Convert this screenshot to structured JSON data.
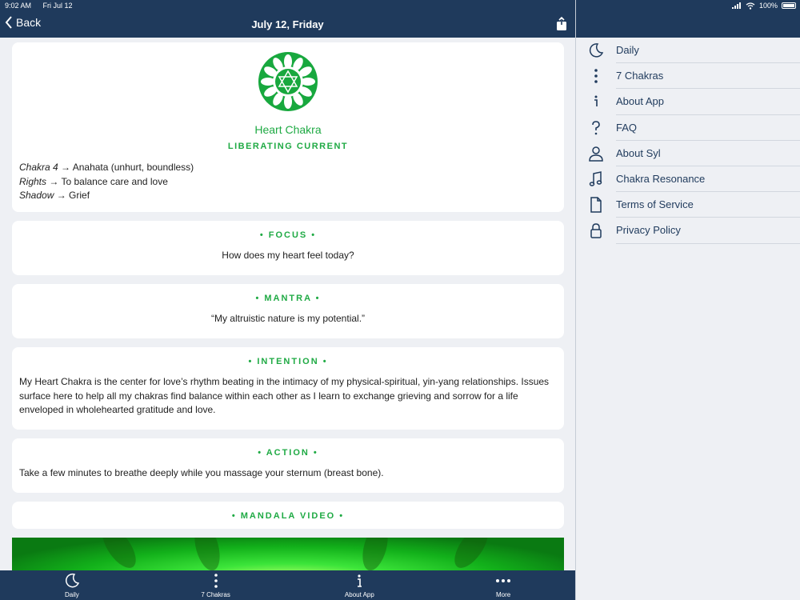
{
  "status": {
    "time": "9:02 AM",
    "date": "Fri Jul 12",
    "battery": "100%"
  },
  "nav": {
    "back_label": "Back",
    "title": "July 12, Friday"
  },
  "hero": {
    "name": "Heart Chakra",
    "subtitle": "LIBERATING CURRENT",
    "facts": [
      {
        "key": "Chakra 4",
        "arrow": " → ",
        "value": "Anahata (unhurt, boundless)"
      },
      {
        "key": "Rights",
        "arrow": " → ",
        "value": "To balance care and love"
      },
      {
        "key": "Shadow",
        "arrow": " → ",
        "value": "Grief"
      }
    ]
  },
  "sections": {
    "focus": {
      "title": "• FOCUS •",
      "body": "How does my heart feel today?"
    },
    "mantra": {
      "title": "• MANTRA •",
      "body": "“My altruistic nature is my potential.”"
    },
    "intention": {
      "title": "• INTENTION •",
      "body": "My Heart Chakra is the center for love’s rhythm beating in the intimacy of my physical-spiritual, yin-yang relationships. Issues surface here to help all my chakras find balance within each other as I learn to exchange grieving and sorrow for a life enveloped in wholehearted gratitude and love."
    },
    "action": {
      "title": "• ACTION •",
      "body": "Take a few minutes to breathe deeply while you massage your sternum (breast bone)."
    },
    "mandala": {
      "title": "• MANDALA VIDEO •"
    }
  },
  "tabs": [
    {
      "label": "Daily",
      "icon": "moon-icon"
    },
    {
      "label": "7 Chakras",
      "icon": "dots-vertical-icon"
    },
    {
      "label": "About App",
      "icon": "info-icon"
    },
    {
      "label": "More",
      "icon": "dots-horizontal-icon"
    }
  ],
  "menu": [
    {
      "label": "Daily",
      "icon": "moon-icon"
    },
    {
      "label": "7 Chakras",
      "icon": "dots-vertical-icon"
    },
    {
      "label": "About App",
      "icon": "info-icon"
    },
    {
      "label": "FAQ",
      "icon": "question-icon"
    },
    {
      "label": "About Syl",
      "icon": "person-icon"
    },
    {
      "label": "Chakra Resonance",
      "icon": "music-note-icon"
    },
    {
      "label": "Terms of Service",
      "icon": "document-icon"
    },
    {
      "label": "Privacy Policy",
      "icon": "lock-icon"
    }
  ],
  "colors": {
    "accent": "#1faa44",
    "navbar": "#1f3a5c",
    "background": "#eef0f4"
  }
}
